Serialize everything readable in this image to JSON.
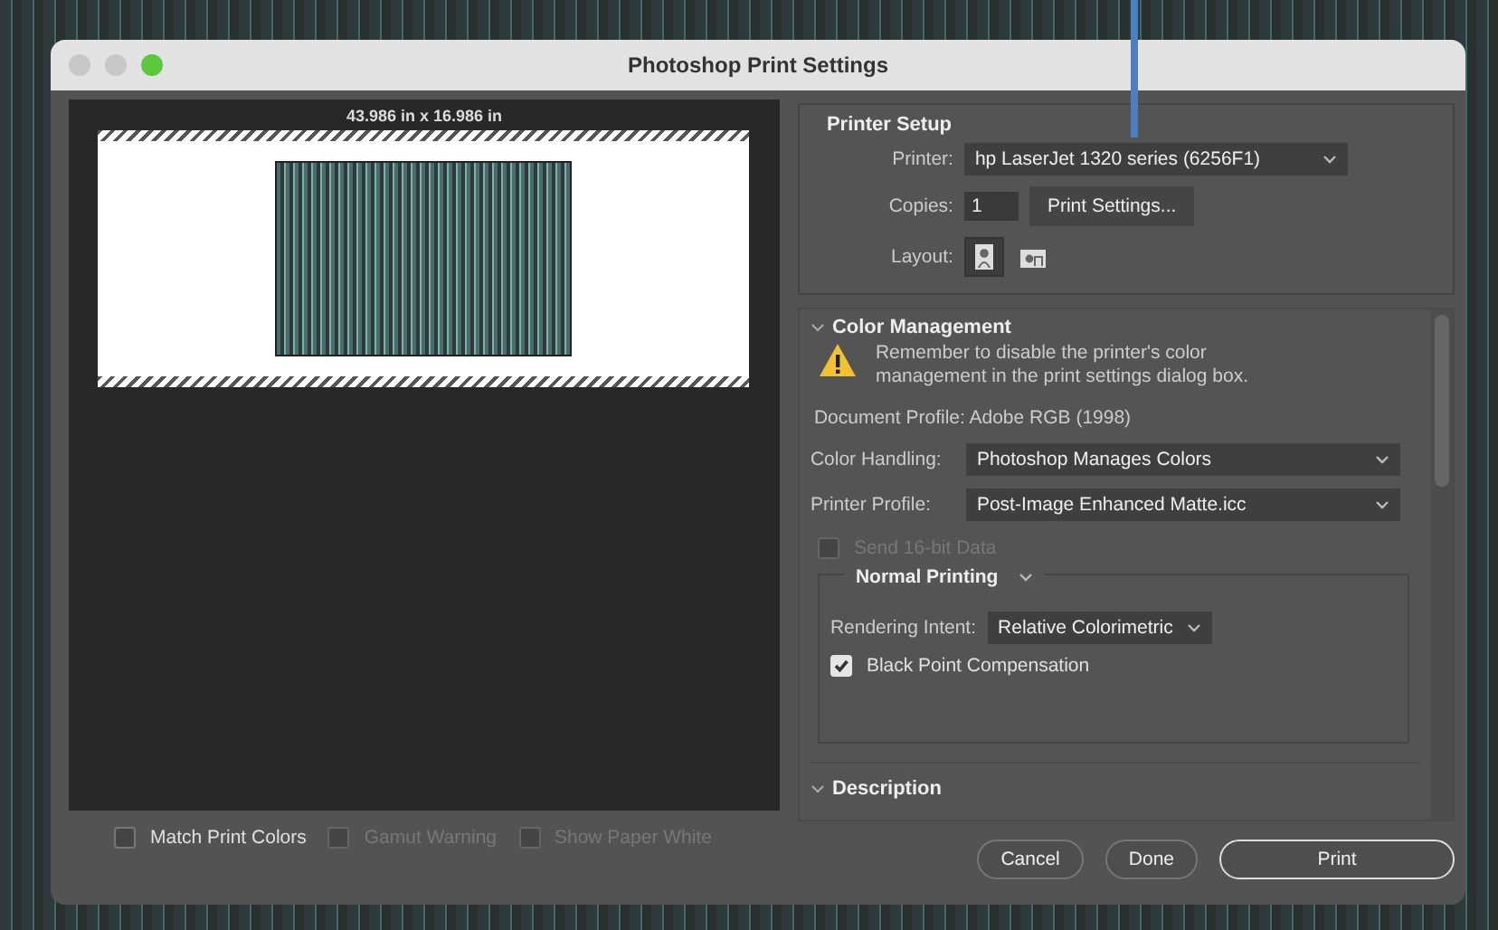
{
  "window": {
    "title": "Photoshop Print Settings"
  },
  "preview": {
    "size_label": "43.986 in x 16.986 in"
  },
  "printer_setup": {
    "title": "Printer Setup",
    "printer_label": "Printer:",
    "printer": "hp LaserJet 1320 series (6256F1)",
    "copies_label": "Copies:",
    "copies": "1",
    "print_settings_button": "Print Settings...",
    "layout_label": "Layout:",
    "layout_options": [
      {
        "kind": "portrait",
        "selected": true
      },
      {
        "kind": "landscape",
        "selected": false
      }
    ]
  },
  "color_management": {
    "title": "Color Management",
    "expanded": true,
    "warning": "Remember to disable the printer's color management in the print settings dialog box.",
    "document_profile": "Document Profile: Adobe RGB (1998)",
    "color_handling_label": "Color Handling:",
    "color_handling": "Photoshop Manages Colors",
    "printer_profile_label": "Printer Profile:",
    "printer_profile": "Post-Image Enhanced Matte.icc",
    "send_16bit": {
      "label": "Send 16-bit Data",
      "checked": false,
      "disabled": true
    },
    "mode": "Normal Printing",
    "rendering_intent_label": "Rendering Intent:",
    "rendering_intent": "Relative Colorimetric",
    "black_point": {
      "label": "Black Point Compensation",
      "checked": true,
      "disabled": false
    }
  },
  "description": {
    "title": "Description",
    "expanded": true
  },
  "bottom_options": [
    {
      "label": "Match Print Colors",
      "checked": false,
      "disabled": false
    },
    {
      "label": "Gamut Warning",
      "checked": false,
      "disabled": true
    },
    {
      "label": "Show Paper White",
      "checked": false,
      "disabled": true
    }
  ],
  "buttons": [
    {
      "label": "Cancel",
      "kind": "secondary"
    },
    {
      "label": "Done",
      "kind": "secondary"
    },
    {
      "label": "Print",
      "kind": "primary"
    }
  ]
}
